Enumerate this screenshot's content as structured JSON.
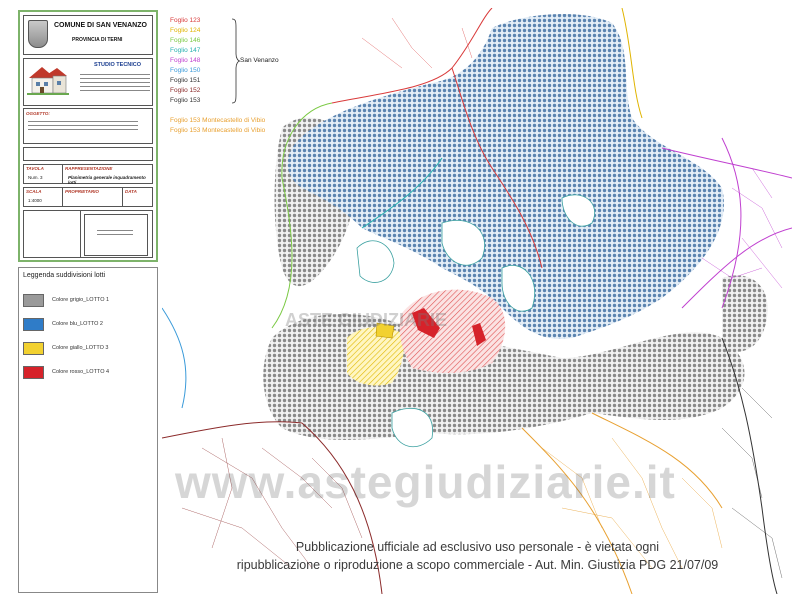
{
  "titleblock": {
    "comune": "COMUNE DI SAN VENANZO",
    "provincia": "PROVINCIA DI TERNI",
    "studio": "STUDIO TECNICO",
    "oggetto_label": "OGGETTO:",
    "tavola_label": "TAVOLA",
    "tavola_value": "Num. 3",
    "rappresentazione_label": "RAPPRESENTAZIONE",
    "rappresentazione_value": "Planimetria generale inquadramento lotti",
    "scala_label": "SCALA",
    "scala_value": "1:4000",
    "proprietario_label": "PROPRIETARIO",
    "data_label": "DATA"
  },
  "legend": {
    "title": "Leggenda suddivisioni lotti",
    "items": [
      {
        "label": "Colore grigio_LOTTO 1",
        "color": "#9a9a9a"
      },
      {
        "label": "Colore blu_LOTTO 2",
        "color": "#2f7cc8"
      },
      {
        "label": "Colore giallo_LOTTO 3",
        "color": "#f2d130"
      },
      {
        "label": "Colore rosso_LOTTO 4",
        "color": "#d6222a"
      }
    ]
  },
  "fogli": [
    {
      "label": "Foglio 123",
      "color": "#d93a3a"
    },
    {
      "label": "Foglio 124",
      "color": "#e0b400"
    },
    {
      "label": "Foglio 146",
      "color": "#7ac943"
    },
    {
      "label": "Foglio 147",
      "color": "#26b0b0"
    },
    {
      "label": "Foglio 148",
      "color": "#c040d0"
    },
    {
      "label": "Foglio 150",
      "color": "#3a9ad9"
    },
    {
      "label": "Foglio 151",
      "color": "#333333"
    },
    {
      "label": "Foglio 152",
      "color": "#8b2a2a"
    },
    {
      "label": "Foglio 153",
      "color": "#333333"
    }
  ],
  "fogli_group_label": "San Venanzo",
  "fogli_montecastello": [
    {
      "label": "Foglio 153 Montecastello di Vibio",
      "color": "#e8a030"
    },
    {
      "label": "Foglio 153 Montecastello di Vibio",
      "color": "#e8a030"
    }
  ],
  "watermark": "www.astegiudiziarie.it",
  "watermark_logo": "ASTE GIUDIZIARIE",
  "disclaimer_line1": "Pubblicazione ufficiale ad esclusivo uso personale - è vietata ogni",
  "disclaimer_line2": "ripubblicazione o riproduzione a scopo commerciale - Aut. Min. Giustizia PDG 21/07/09"
}
